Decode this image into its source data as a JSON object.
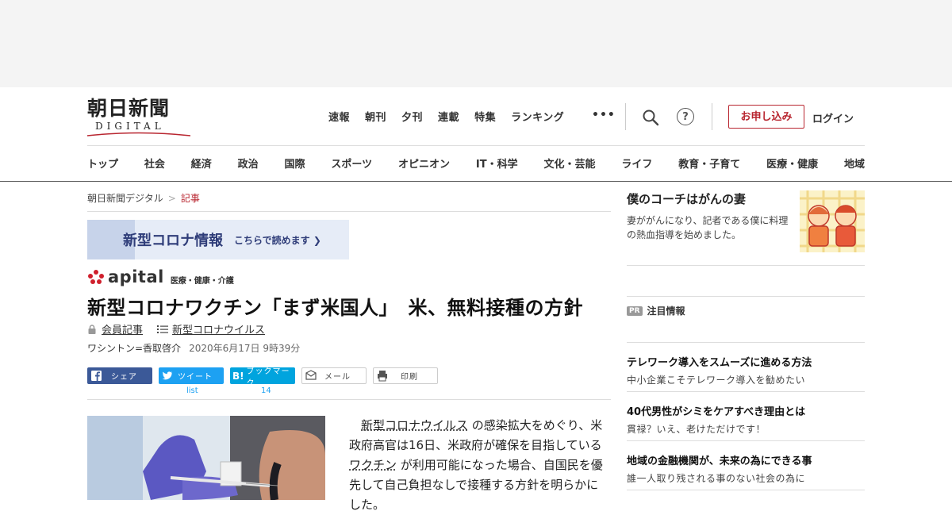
{
  "logo": {
    "main": "朝日新聞",
    "sub": "DIGITAL"
  },
  "topnav": [
    "速報",
    "朝刊",
    "夕刊",
    "連載",
    "特集",
    "ランキング"
  ],
  "more_dots": "•••",
  "help_glyph": "?",
  "signup_label": "お申し込み",
  "login_label": "ログイン",
  "categories": [
    "トップ",
    "社会",
    "経済",
    "政治",
    "国際",
    "スポーツ",
    "オピニオン",
    "IT・科学",
    "文化・芸能",
    "ライフ",
    "教育・子育て",
    "医療・健康",
    "地域"
  ],
  "breadcrumb": {
    "home": "朝日新聞デジタル",
    "separator": ">",
    "current": "記事"
  },
  "banner": {
    "title": "新型コロナ情報",
    "link": "こちらで読めます ❯"
  },
  "apital": {
    "name": "apital",
    "tag": "医療・健康・介護"
  },
  "article": {
    "headline": "新型コロナワクチン「まず米国人」　米、無料接種の方針",
    "member_label": "会員記事",
    "topic_label": "新型コロナウイルス",
    "byline": "ワシントン=香取啓介",
    "date": "2020年6月17日 9時39分",
    "body": {
      "indent": "　",
      "link1": "新型コロナウイルス",
      "t1": " の感染拡大をめぐり、米政府高官は16日、米政府が確保を目指している ",
      "link2": "ワクチン",
      "t2": " が利用可能になった場合、自国民を優先して自己負担なしで接種する方針を明らかにした。"
    }
  },
  "share": {
    "facebook": "シェア",
    "twitter": "ツイート",
    "hatena": "ブックマーク",
    "hatena_icon": "B!",
    "mail": "メール",
    "print": "印刷",
    "twitter_count": "list",
    "hatena_count": "14"
  },
  "sidebar": {
    "feature": {
      "title": "僕のコーチはがんの妻",
      "desc": "妻ががんになり、記者である僕に料理の熱血指導を始めました。"
    },
    "pr": {
      "badge": "PR",
      "heading": "注目情報",
      "items": [
        {
          "title": "テレワーク導入をスムーズに進める方法",
          "desc": "中小企業こそテレワーク導入を勧めたい"
        },
        {
          "title": "40代男性がシミをケアすべき理由とは",
          "desc": "貫禄？いえ、老けただけです！"
        },
        {
          "title": "地域の金融機関が、未来の為にできる事",
          "desc": "誰一人取り残される事のない社会の為に"
        }
      ]
    }
  },
  "colors": {
    "accent": "#b8252f",
    "facebook": "#3b5998",
    "twitter": "#1da1f2",
    "hatena": "#00a4de",
    "banner_text": "#2f3d79"
  }
}
